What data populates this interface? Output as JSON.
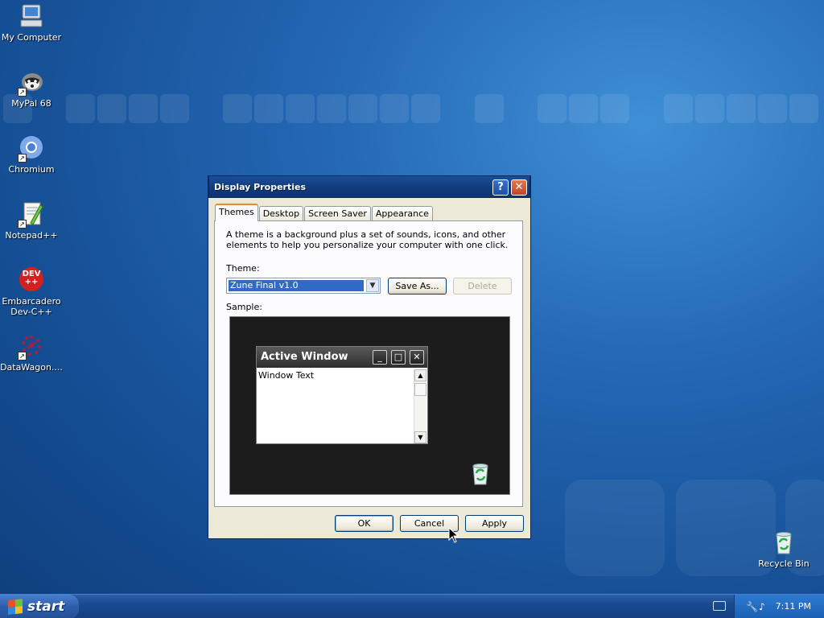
{
  "desktop": {
    "icons": [
      {
        "label": "My Computer",
        "icon": "my-computer-icon"
      },
      {
        "label": "MyPal 68",
        "icon": "mypal-icon"
      },
      {
        "label": "Chromium",
        "icon": "chromium-icon"
      },
      {
        "label": "Notepad++",
        "icon": "notepadpp-icon"
      },
      {
        "label": "Embarcadero Dev-C++",
        "icon": "devcpp-icon",
        "badge": "DEV ++"
      },
      {
        "label": "DataWagon....",
        "icon": "datawagon-icon"
      }
    ],
    "recycle_bin": {
      "label": "Recycle Bin",
      "icon": "recycle-bin-icon"
    }
  },
  "dialog": {
    "title": "Display Properties",
    "help_glyph": "?",
    "close_glyph": "✕",
    "tabs": [
      {
        "label": "Themes",
        "active": true
      },
      {
        "label": "Desktop",
        "active": false
      },
      {
        "label": "Screen Saver",
        "active": false
      },
      {
        "label": "Appearance",
        "active": false
      }
    ],
    "description": "A theme is a background plus a set of sounds, icons, and other elements to help you personalize your computer with one click.",
    "theme_label": "Theme:",
    "theme_value": "Zune Final v1.0",
    "save_as_label": "Save As...",
    "delete_label": "Delete",
    "sample_label": "Sample:",
    "sample": {
      "window_title": "Active Window",
      "window_text": "Window Text"
    },
    "ok_label": "OK",
    "cancel_label": "Cancel",
    "apply_label": "Apply"
  },
  "taskbar": {
    "start_label": "start",
    "clock": "7:11 PM"
  },
  "colors": {
    "desktop": "#1f5ea8",
    "titlebar": "#103a79",
    "selection": "#316ac5"
  }
}
